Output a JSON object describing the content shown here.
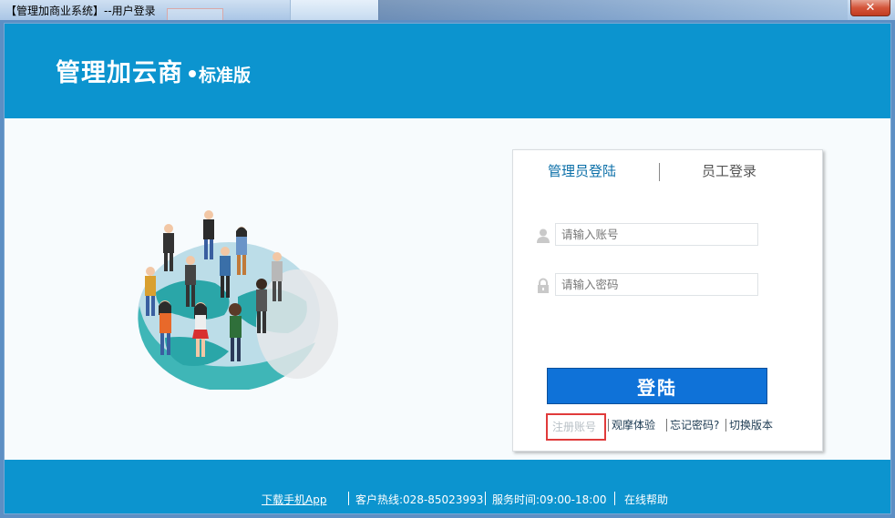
{
  "window": {
    "title": "【管理加商业系统】--用户登录",
    "close_label": "✕"
  },
  "header": {
    "brand_name": "管理加云商",
    "edition": "标准版"
  },
  "login": {
    "tabs": [
      {
        "label": "管理员登陆",
        "active": true
      },
      {
        "label": "员工登录",
        "active": false
      }
    ],
    "account_placeholder": "请输入账号",
    "password_placeholder": "请输入密码",
    "account_value": "",
    "password_value": "",
    "submit_label": "登陆",
    "links": {
      "register": "注册账号",
      "demo": "观摩体验",
      "forgot": "忘记密码?",
      "switch_version": "切换版本"
    }
  },
  "footer": {
    "download_app": "下载手机App",
    "hotline": "客户热线:028-85023993",
    "service_hours": "服务时间:09:00-18:00",
    "online_help": "在线帮助"
  },
  "colors": {
    "brand_blue": "#0c94cf",
    "button_blue": "#0f72d8",
    "active_tab": "#0b6fa8",
    "highlight_red": "#e03a3a"
  },
  "icons": [
    "close-icon",
    "user-icon",
    "lock-icon",
    "people-globe-illustration"
  ]
}
